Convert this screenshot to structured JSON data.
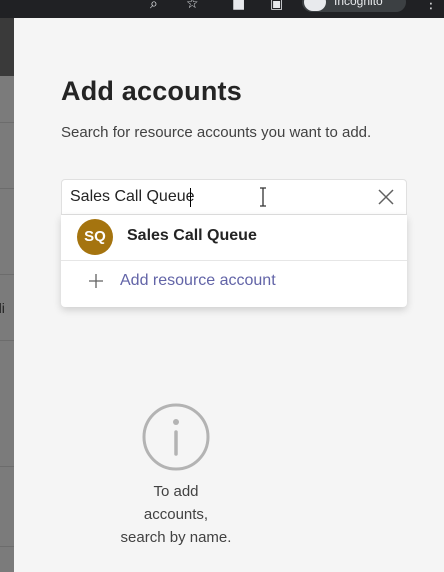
{
  "browser": {
    "profile_label": "Incognito"
  },
  "panel": {
    "title": "Add accounts",
    "subtitle": "Search for resource accounts you want to add."
  },
  "search": {
    "value": "Sales Call Queue",
    "clear_icon": "close-icon"
  },
  "results": [
    {
      "initials": "SQ",
      "name": "Sales Call Queue",
      "avatar_color": "#a5740f"
    }
  ],
  "add_resource": {
    "label": "Add resource account",
    "icon": "plus-icon"
  },
  "empty_state": {
    "icon": "info-icon",
    "lines": [
      "To add",
      "accounts,",
      "search by name."
    ]
  },
  "colors": {
    "accent": "#6264a7",
    "avatar": "#a5740f",
    "panel_background": "#f5f5f5"
  }
}
